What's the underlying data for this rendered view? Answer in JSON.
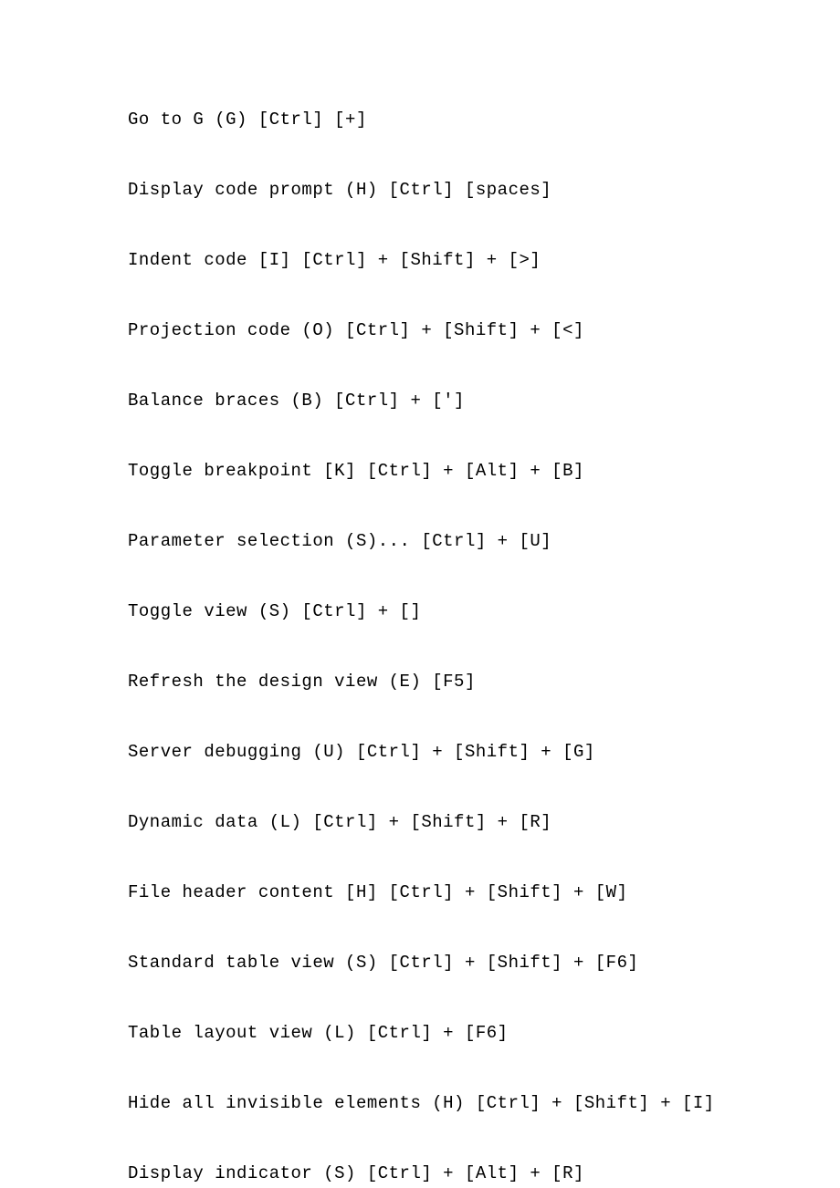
{
  "lines": [
    "Go to G (G) [Ctrl] [+]",
    "Display code prompt (H) [Ctrl] [spaces]",
    "Indent code [I] [Ctrl] + [Shift] + [>]",
    "Projection code (O) [Ctrl] + [Shift] + [<]",
    "Balance braces (B) [Ctrl] + [']",
    "Toggle breakpoint [K] [Ctrl] + [Alt] + [B]",
    "Parameter selection (S)... [Ctrl] + [U]",
    "Toggle view (S) [Ctrl] + []",
    "Refresh the design view (E) [F5]",
    "Server debugging (U) [Ctrl] + [Shift] + [G]",
    "Dynamic data (L) [Ctrl] + [Shift] + [R]",
    "File header content [H] [Ctrl] + [Shift] + [W]",
    "Standard table view (S) [Ctrl] + [Shift] + [F6]",
    "Table layout view (L) [Ctrl] + [F6]",
    "Hide all invisible elements (H) [Ctrl] + [Shift] + [I]",
    "Display indicator (S) [Ctrl] + [Alt] + [R]"
  ]
}
